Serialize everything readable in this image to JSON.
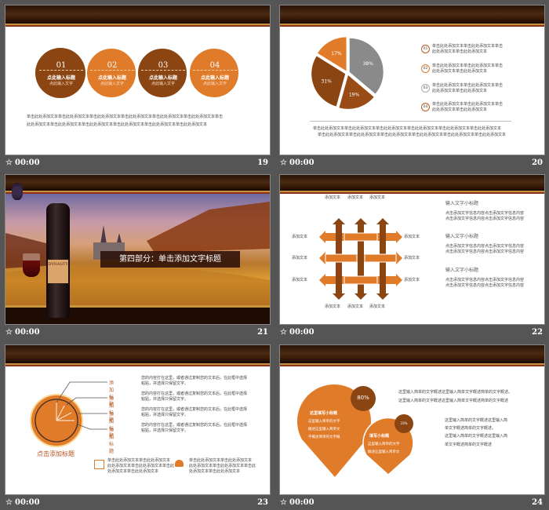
{
  "footer_time": "00:00",
  "star_icon": "star-outline-icon",
  "colors": {
    "dark_brown": "#8b4513",
    "orange": "#e07b2a",
    "grey": "#8a8a8a",
    "background": "#555555"
  },
  "slides": [
    {
      "number": "19",
      "circles": [
        {
          "num": "01",
          "title": "点此输入标题",
          "sub": "点此输入文字"
        },
        {
          "num": "02",
          "title": "点此输入标题",
          "sub": "点此输入文字"
        },
        {
          "num": "03",
          "title": "点此输入标题",
          "sub": "点此输入文字"
        },
        {
          "num": "04",
          "title": "点此输入标题",
          "sub": "点此输入文字"
        }
      ],
      "body": [
        "单击此处添加文本单击此处添加文本单击此处添加文本单击此处添加文本单击此处添加文本单击此处添加文本单击",
        "此处添加文本单击此处添加文本单击此处添加文本单击此处添加文本单击此处添加文本单击此处添加文本"
      ]
    },
    {
      "number": "20",
      "pie": [
        {
          "label": "38%",
          "value": 38,
          "color": "#8a8a8a"
        },
        {
          "label": "19%",
          "value": 19,
          "color": "#9a4c16"
        },
        {
          "label": "31%",
          "value": 31,
          "color": "#8b4513"
        },
        {
          "label": "17%",
          "value": 17,
          "color": "#e07b2a"
        }
      ],
      "legend": [
        {
          "num": "01",
          "line1": "单击此处添加文本单击此处添加文本单击",
          "line2": "此处添加文本单击此处添加文本"
        },
        {
          "num": "02",
          "line1": "单击此处添加文本单击此处添加文本单击",
          "line2": "此处添加文本单击此处添加文本"
        },
        {
          "num": "03",
          "line1": "单击此处添加文本单击此处添加文本单击",
          "line2": "此处添加文本单击此处添加文本"
        },
        {
          "num": "04",
          "line1": "单击此处添加文本单击此处添加文本单击",
          "line2": "此处添加文本单击此处添加文本"
        }
      ],
      "body": [
        "单击此处添加文本单击此处添加文本单击此处添加文本单击此处添加文本单击此处添加文本单击此处添加文本",
        "单击此处添加文本单击此处添加文本单击此处添加文本单击此处添加文本单击此处添加文本单击此处添加文本"
      ]
    },
    {
      "number": "21",
      "title": "第四部分：单击添加文字标题",
      "bottle_label": "DYNASTY"
    },
    {
      "number": "22",
      "top_labels": [
        "添加文本",
        "添加文本",
        "添加文本"
      ],
      "bottom_labels": [
        "添加文本",
        "添加文本",
        "添加文本"
      ],
      "left_labels": [
        "添加文本",
        "添加文本",
        "添加文本"
      ],
      "right_labels": [
        "添加文本",
        "添加文本",
        "添加文本"
      ],
      "blocks": [
        {
          "title": "输入文字小标题",
          "line1": "点击添加文字信息内容点击添加文字信息内容",
          "line2": "点击添加文字信息内容点击添加文字信息内容"
        },
        {
          "title": "输入文字小标题",
          "line1": "点击添加文字信息内容点击添加文字信息内容",
          "line2": "点击添加文字信息内容点击添加文字信息内容"
        },
        {
          "title": "输入文字小标题",
          "line1": "点击添加文字信息内容点击添加文字信息内容",
          "line2": "点击添加文字信息内容点击添加文字信息内容"
        }
      ]
    },
    {
      "number": "23",
      "items": [
        {
          "label": "添加标题",
          "line1": "您的内容打在这里，或者通过复制您的文本后，在此框中选择",
          "line2": "粘贴，并选择只保留文字。"
        },
        {
          "label": "添加标题",
          "line1": "您的内容打在这里，或者通过复制您的文本后，在此框中选择",
          "line2": "粘贴，并选择只保留文字。"
        },
        {
          "label": "添加标题",
          "line1": "您的内容打在这里，或者通过复制您的文本后，在此框中选择",
          "line2": "粘贴，并选择只保留文字。"
        },
        {
          "label": "添加标题",
          "line1": "您的内容打在这里，或者通过复制您的文本后，在此框中选择",
          "line2": "粘贴，并选择只保留文字。"
        }
      ],
      "clock_title": "点击添加标题",
      "notes": [
        {
          "icon": "documents-icon",
          "lines": [
            "单击此处添加文本单击此处添加文本",
            "此处添加文本单击此处添加文本单击此",
            "处添加文本单击此处添加文本"
          ]
        },
        {
          "icon": "person-icon",
          "lines": [
            "单击此处添加文本单击此处添加文本",
            "此处添加文本单击此处添加文本单击此",
            "处添加文本单击此处添加文本"
          ]
        }
      ]
    },
    {
      "number": "24",
      "big_drop": {
        "percent": "80%",
        "title": "这里填写小标题",
        "lines": [
          "这里输入简单的文字",
          "概述这里输入简单文",
          "字概述简单的文字概"
        ]
      },
      "small_drop": {
        "percent": "33%",
        "title": "填写小标题",
        "lines": [
          "这里输入简单的文字",
          "概述这里输入简单文"
        ]
      },
      "top_text": [
        "这里输入简单的文字概述这里输入简单文字概述简单的文字概述。",
        "这里输入简单的文字概述这里输入简单文字概述简单的文字概述"
      ],
      "side_text": [
        "这里输入简单的文字概述这里输入简",
        "单文字概述简单的文字概述。",
        "这里输入简单的文字概述这里输入简",
        "单文字概述简单的文字概述"
      ]
    }
  ]
}
